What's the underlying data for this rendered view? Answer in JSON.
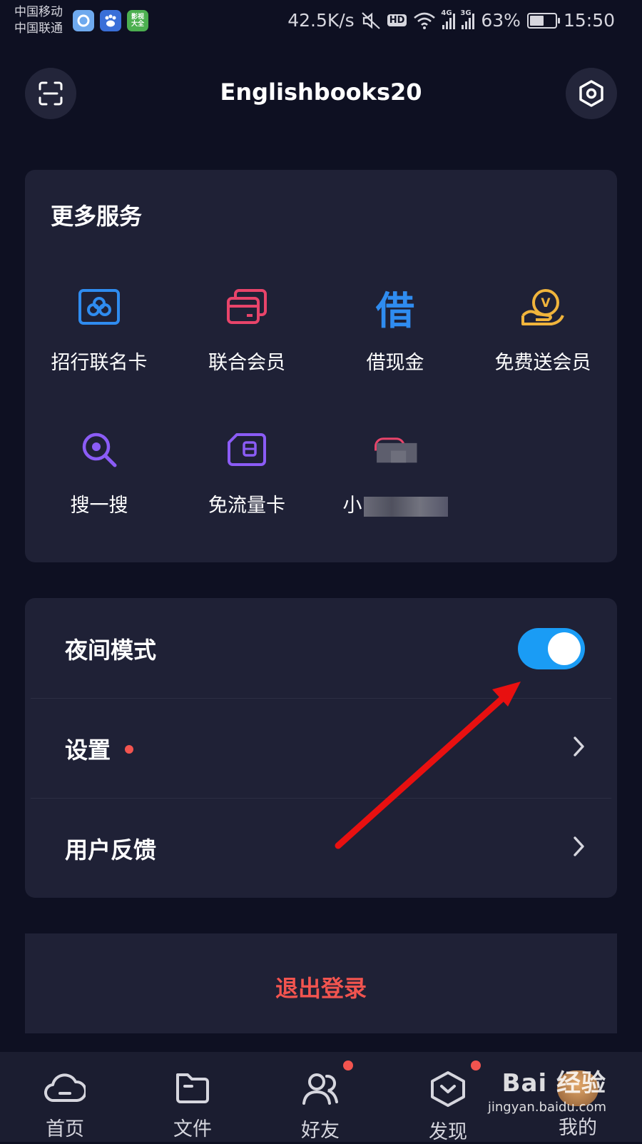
{
  "status_bar": {
    "carrier1": "中国移动",
    "carrier2": "中国联通",
    "app_icons": [
      "qq-browser-icon",
      "baidu-icon",
      "video-app-icon"
    ],
    "video_app_label": "影视大全",
    "net_speed": "42.5K/s",
    "hd": "HD",
    "sig1_tag": "4G",
    "sig2_tag": "3G",
    "battery": "63%",
    "battery_level": 0.63,
    "time": "15:50"
  },
  "header": {
    "title": "Englishbooks20"
  },
  "services": {
    "title": "更多服务",
    "items": [
      {
        "label": "招行联名卡",
        "icon": "bank-card-icon",
        "color": "#2f8cf0"
      },
      {
        "label": "联合会员",
        "icon": "cards-icon",
        "color": "#e8446a"
      },
      {
        "label": "借现金",
        "icon": "borrow-icon",
        "color": "#2f8cf0",
        "glyph": "借"
      },
      {
        "label": "免费送会员",
        "icon": "vip-hand-icon",
        "color": "#f0b43c",
        "glyph": "V"
      },
      {
        "label": "搜一搜",
        "icon": "search-icon",
        "color": "#8b5cf6"
      },
      {
        "label": "免流量卡",
        "icon": "sim-card-icon",
        "color": "#8b5cf6"
      },
      {
        "label": "小",
        "icon": "blurred-icon",
        "color": "#e8446a"
      }
    ]
  },
  "settings": {
    "night_mode": {
      "label": "夜间模式",
      "enabled": true
    },
    "settings_label": "设置",
    "feedback_label": "用户反馈"
  },
  "logout": "退出登录",
  "nav": [
    {
      "label": "首页",
      "icon": "cloud-icon",
      "badge": false
    },
    {
      "label": "文件",
      "icon": "folder-icon",
      "badge": false
    },
    {
      "label": "好友",
      "icon": "friends-icon",
      "badge": true
    },
    {
      "label": "发现",
      "icon": "discover-icon",
      "badge": true
    },
    {
      "label": "我的",
      "icon": "profile-icon",
      "badge": false
    }
  ],
  "watermark": {
    "logo": "Bai 经验",
    "url": "jingyan.baidu.com"
  },
  "colors": {
    "background": "#0e1022",
    "card": "#1f2136",
    "accent_blue": "#1a9cf5",
    "danger": "#f2544f",
    "annotation_arrow": "#e81010"
  }
}
